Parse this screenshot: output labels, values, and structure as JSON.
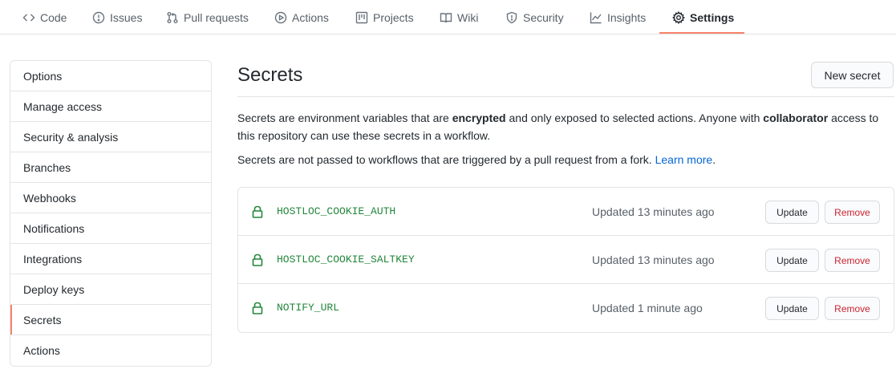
{
  "tabs": [
    {
      "label": "Code",
      "icon": "code-icon"
    },
    {
      "label": "Issues",
      "icon": "issue-icon"
    },
    {
      "label": "Pull requests",
      "icon": "pull-request-icon"
    },
    {
      "label": "Actions",
      "icon": "play-icon"
    },
    {
      "label": "Projects",
      "icon": "project-icon"
    },
    {
      "label": "Wiki",
      "icon": "book-icon"
    },
    {
      "label": "Security",
      "icon": "shield-icon"
    },
    {
      "label": "Insights",
      "icon": "graph-icon"
    },
    {
      "label": "Settings",
      "icon": "gear-icon",
      "active": true
    }
  ],
  "sidebar": {
    "items": [
      {
        "label": "Options"
      },
      {
        "label": "Manage access"
      },
      {
        "label": "Security & analysis"
      },
      {
        "label": "Branches"
      },
      {
        "label": "Webhooks"
      },
      {
        "label": "Notifications"
      },
      {
        "label": "Integrations"
      },
      {
        "label": "Deploy keys"
      },
      {
        "label": "Secrets",
        "active": true
      },
      {
        "label": "Actions"
      }
    ]
  },
  "main": {
    "title": "Secrets",
    "new_secret_label": "New secret",
    "desc1": {
      "part1": "Secrets are environment variables that are ",
      "bold1": "encrypted",
      "part2": " and only exposed to selected actions. Anyone with ",
      "bold2": "collaborator",
      "part3": " access to this repository can use these secrets in a workflow."
    },
    "desc2": {
      "text": "Secrets are not passed to workflows that are triggered by a pull request from a fork. ",
      "link": "Learn more",
      "end": "."
    },
    "secrets": [
      {
        "name": "HOSTLOC_COOKIE_AUTH",
        "updated": "Updated 13 minutes ago"
      },
      {
        "name": "HOSTLOC_COOKIE_SALTKEY",
        "updated": "Updated 13 minutes ago"
      },
      {
        "name": "NOTIFY_URL",
        "updated": "Updated 1 minute ago"
      }
    ],
    "update_label": "Update",
    "remove_label": "Remove"
  },
  "colors": {
    "accent_underline": "#f9826c",
    "secret_name": "#22863a",
    "link": "#0366d6",
    "danger": "#cb2431"
  }
}
